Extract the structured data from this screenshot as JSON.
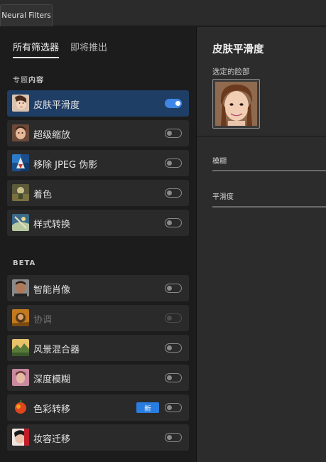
{
  "window": {
    "tab_label": "Neural Filters"
  },
  "subtabs": [
    {
      "label": "所有筛选器",
      "active": true
    },
    {
      "label": "即将推出",
      "active": false
    }
  ],
  "sections": {
    "featured": {
      "title_prefix": "专题",
      "title_bold": "内容"
    },
    "beta": {
      "title": "BETA"
    }
  },
  "featured_filters": [
    {
      "label": "皮肤平滑度",
      "icon": "portrait-face-thumb",
      "enabled": true,
      "selected": true
    },
    {
      "label": "超级缩放",
      "icon": "zoom-face-thumb",
      "enabled": false
    },
    {
      "label": "移除 JPEG 伪影",
      "icon": "jpeg-artifact-thumb",
      "enabled": false
    },
    {
      "label": "着色",
      "icon": "colorize-thumb",
      "enabled": false
    },
    {
      "label": "样式转换",
      "icon": "style-transfer-thumb",
      "enabled": false
    }
  ],
  "beta_filters": [
    {
      "label": "智能肖像",
      "icon": "smart-portrait-thumb",
      "enabled": false
    },
    {
      "label": "协调",
      "icon": "harmonization-thumb",
      "enabled": false,
      "disabled": true
    },
    {
      "label": "风景混合器",
      "icon": "landscape-mixer-thumb",
      "enabled": false
    },
    {
      "label": "深度模糊",
      "icon": "depth-blur-thumb",
      "enabled": false
    },
    {
      "label": "色彩转移",
      "icon": "color-transfer-thumb",
      "enabled": false,
      "badge": "新"
    },
    {
      "label": "妆容迁移",
      "icon": "makeup-transfer-thumb",
      "enabled": false
    }
  ],
  "right_panel": {
    "title": "皮肤平滑度",
    "face_label": "选定的脸部",
    "sliders": [
      {
        "label": "模糊"
      },
      {
        "label": "平滑度"
      }
    ]
  },
  "colors": {
    "selected_row": "#1f3e66",
    "toggle_on": "#3f86e6",
    "badge": "#2a7de0"
  }
}
